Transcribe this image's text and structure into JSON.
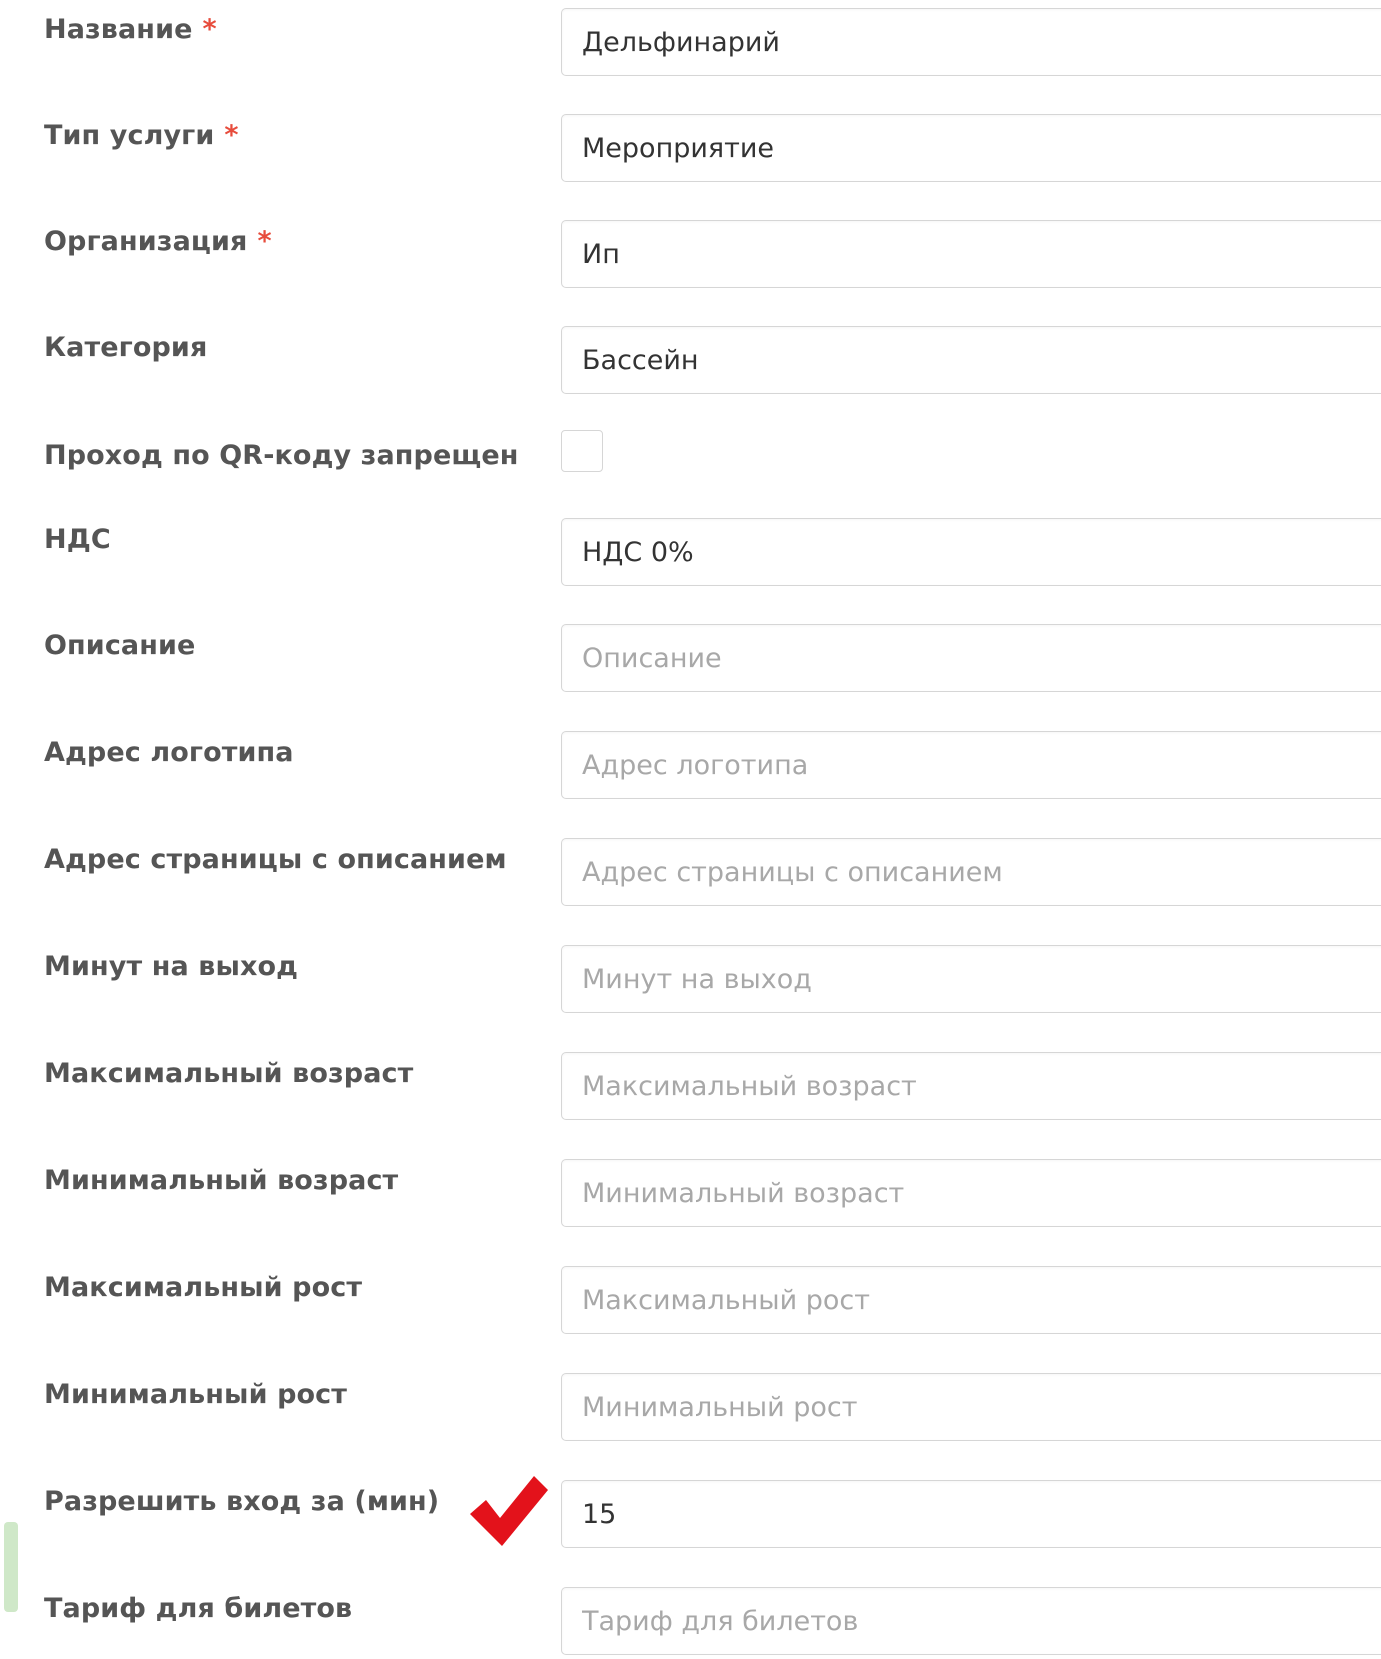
{
  "form": {
    "name": {
      "label": "Название",
      "required_mark": "*",
      "value": "Дельфинарий"
    },
    "service_type": {
      "label": "Тип услуги",
      "required_mark": "*",
      "value": "Мероприятие"
    },
    "organization": {
      "label": "Организация",
      "required_mark": "*",
      "value": "Ип"
    },
    "category": {
      "label": "Категория",
      "value": "Бассейн"
    },
    "qr_forbidden": {
      "label": "Проход по QR-коду запрещен",
      "checked": false
    },
    "vat": {
      "label": "НДС",
      "value": "НДС 0%"
    },
    "description": {
      "label": "Описание",
      "value": "",
      "placeholder": "Описание"
    },
    "logo_url": {
      "label": "Адрес логотипа",
      "value": "",
      "placeholder": "Адрес логотипа"
    },
    "page_url": {
      "label": "Адрес страницы с описанием",
      "value": "",
      "placeholder": "Адрес страницы с описанием"
    },
    "minutes_per_exit": {
      "label": "Минут на выход",
      "value": "",
      "placeholder": "Минут на выход"
    },
    "max_age": {
      "label": "Максимальный возраст",
      "value": "",
      "placeholder": "Максимальный возраст"
    },
    "min_age": {
      "label": "Минимальный возраст",
      "value": "",
      "placeholder": "Минимальный возраст"
    },
    "max_height": {
      "label": "Максимальный рост",
      "value": "",
      "placeholder": "Максимальный рост"
    },
    "min_height": {
      "label": "Минимальный рост",
      "value": "",
      "placeholder": "Минимальный рост"
    },
    "allow_entry_before": {
      "label": "Разрешить вход за (мин)",
      "value": "15"
    },
    "ticket_tariff": {
      "label": "Тариф для билетов",
      "value": "",
      "placeholder": "Тариф для билетов"
    }
  },
  "colors": {
    "label": "#555555",
    "required": "#e74c3c",
    "placeholder": "#a8a8a8",
    "border": "#d6d6d6",
    "annotation_check": "#e3121b"
  },
  "annotation": {
    "icon": "red-checkmark-icon"
  }
}
